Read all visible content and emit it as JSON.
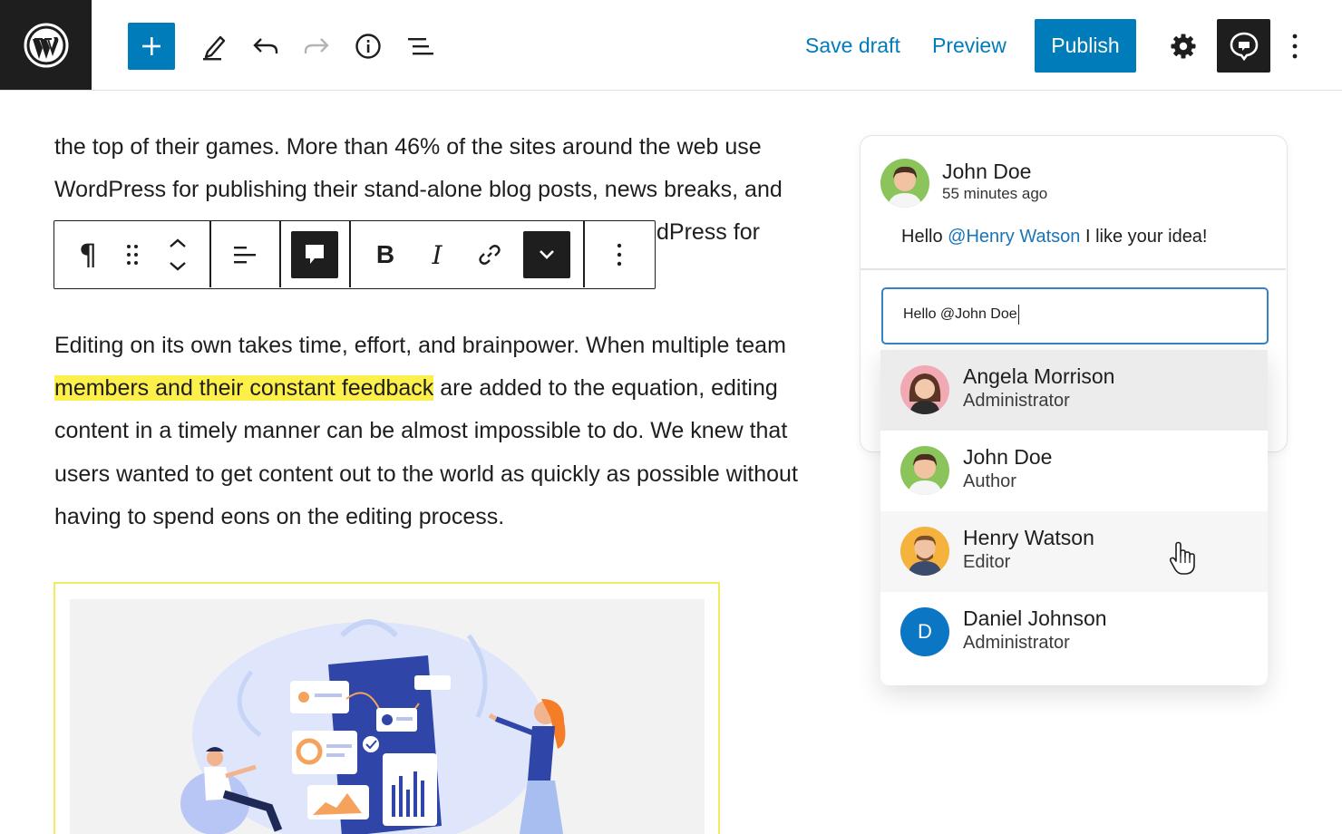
{
  "toolbar": {
    "save_draft": "Save draft",
    "preview": "Preview",
    "publish": "Publish",
    "icons": [
      "wordpress-logo",
      "plus-icon",
      "pencil-icon",
      "undo-icon",
      "redo-icon",
      "info-icon",
      "list-view-icon",
      "gear-icon",
      "comment-icon",
      "kebab-icon"
    ],
    "accent": "#007cba"
  },
  "content": {
    "para1": {
      "line1": "the top of their games. More than 46% of the sites around the web use",
      "line2": "WordPress for publishing their stand-alone blog posts, news breaks, and",
      "line3_visible": "dPress for"
    },
    "para2": {
      "line1": "Editing on its own takes time, effort, and brainpower. When multiple team",
      "line2_highlight": "members and their constant feedback",
      "line2_rest": " are added to the equation, editing",
      "line3": "content in a timely manner can be almost impossible to do. We knew that",
      "line4": "users wanted to get content out to the world as quickly as possible without",
      "line5": "having to spend eons on the editing process."
    },
    "highlight_color": "#fdf04a"
  },
  "block_toolbar": {
    "icons": [
      "paragraph-icon",
      "drag-handle-icon",
      "move-up-down-icon",
      "align-icon",
      "comment-icon",
      "bold-icon",
      "italic-icon",
      "link-icon",
      "chevron-down-icon",
      "kebab-icon"
    ],
    "bold_label": "B",
    "italic_label": "I",
    "paragraph_label": "¶"
  },
  "comment": {
    "author": "John Doe",
    "time": "55 minutes ago",
    "text_before": "Hello ",
    "mention": "@Henry Watson",
    "text_after": " I like your idea!",
    "reply_value": "Hello @John Doe"
  },
  "mention_list": [
    {
      "name": "Angela Morrison",
      "role": "Administrator",
      "state": "hover"
    },
    {
      "name": "John Doe",
      "role": "Author",
      "state": "normal"
    },
    {
      "name": "Henry Watson",
      "role": "Editor",
      "state": "active"
    },
    {
      "name": "Daniel Johnson",
      "role": "Administrator",
      "state": "normal",
      "initial": "D"
    }
  ]
}
